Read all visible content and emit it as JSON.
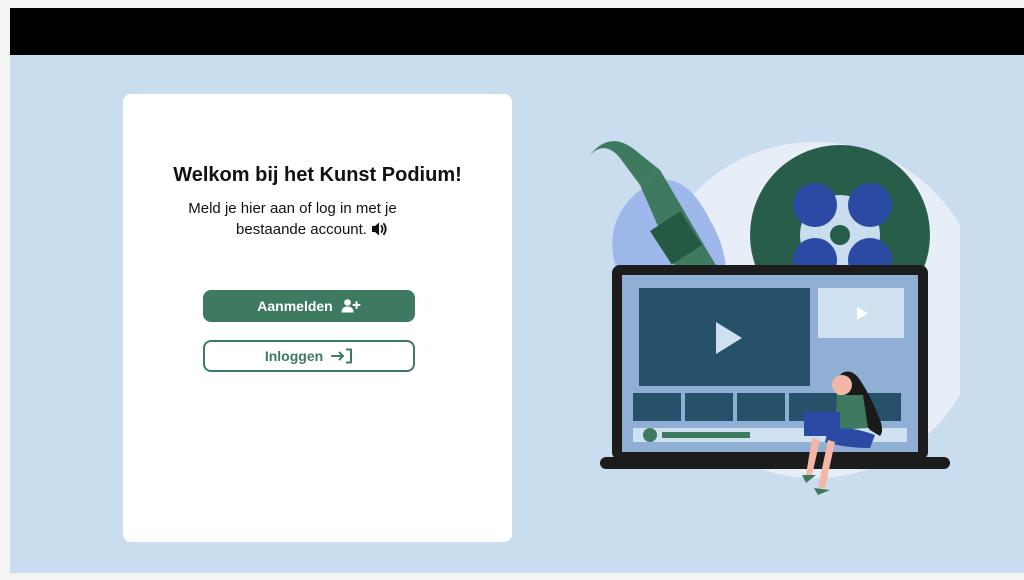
{
  "welcome": {
    "title": "Welkom bij het Kunst Podium!",
    "subtitle_line1": "Meld je hier aan of log in met je",
    "subtitle_line2": "bestaande account."
  },
  "buttons": {
    "signup_label": "Aanmelden",
    "login_label": "Inloggen"
  },
  "icons": {
    "speaker": "speaker-icon",
    "add_user": "add-user-icon",
    "login": "login-arrow-icon",
    "play": "play-icon"
  },
  "colors": {
    "brand_green": "#3d7a5f",
    "background": "#c9ddef",
    "topbar": "#000000",
    "card": "#ffffff"
  }
}
